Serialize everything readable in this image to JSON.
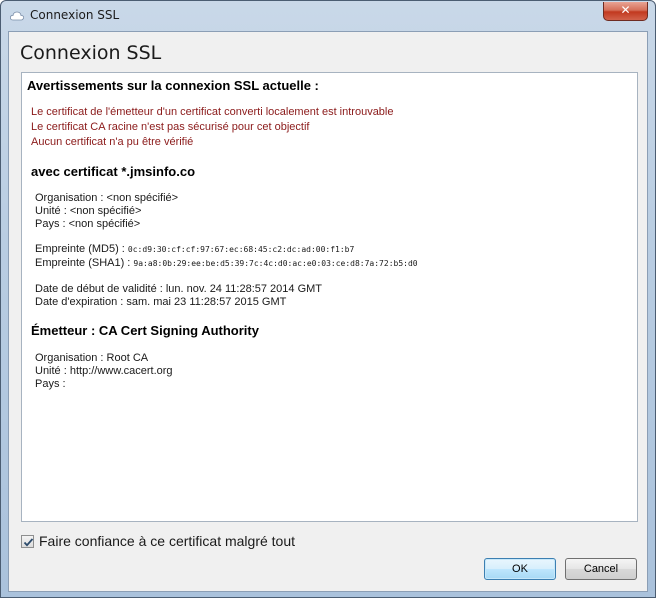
{
  "window": {
    "title": "Connexion SSL",
    "close_label": "✕",
    "app_icon": "cloud-icon"
  },
  "dialog": {
    "title": "Connexion SSL"
  },
  "warnings": {
    "heading": "Avertissements sur la connexion SSL actuelle :",
    "items": [
      "Le certificat de l'émetteur d'un certificat converti localement est introuvable",
      "Le certificat CA racine n'est pas sécurisé pour cet objectif",
      "Aucun certificat n'a pu être vérifié"
    ]
  },
  "certificate": {
    "heading": "avec certificat *.jmsinfo.co",
    "organisation": "Organisation : <non spécifié>",
    "unite": "Unité : <non spécifié>",
    "pays": "Pays : <non spécifié>",
    "md5_label": "Empreinte (MD5) : ",
    "md5_value": "0c:d9:30:cf:cf:97:67:ec:68:45:c2:dc:ad:00:f1:b7",
    "sha1_label": "Empreinte (SHA1) : ",
    "sha1_value": "9a:a8:0b:29:ee:be:d5:39:7c:4c:d0:ac:e0:03:ce:d8:7a:72:b5:d0",
    "valid_from": "Date de début de validité : lun. nov. 24 11:28:57 2014 GMT",
    "valid_to": "Date d'expiration : sam. mai 23 11:28:57 2015 GMT"
  },
  "issuer": {
    "heading": "Émetteur : CA Cert Signing Authority",
    "organisation": "Organisation : Root CA",
    "unite": "Unité : http://www.cacert.org",
    "pays": "Pays :"
  },
  "trust": {
    "label": "Faire confiance à ce certificat malgré tout",
    "checked": true
  },
  "buttons": {
    "ok": "OK",
    "cancel": "Cancel"
  },
  "colors": {
    "warning_text": "#8b1a1a",
    "ok_border": "#3c7fb1"
  }
}
